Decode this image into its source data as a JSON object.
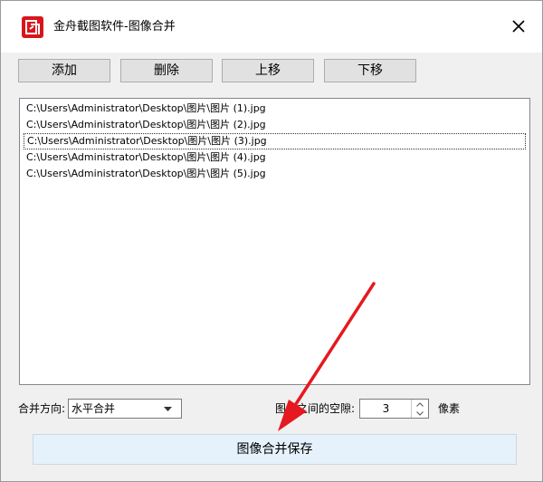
{
  "window": {
    "title": "金舟截图软件-图像合并"
  },
  "toolbar": {
    "add_label": "添加",
    "delete_label": "删除",
    "move_up_label": "上移",
    "move_down_label": "下移"
  },
  "file_list": {
    "items": [
      "C:\\Users\\Administrator\\Desktop\\图片\\图片 (1).jpg",
      "C:\\Users\\Administrator\\Desktop\\图片\\图片 (2).jpg",
      "C:\\Users\\Administrator\\Desktop\\图片\\图片 (3).jpg",
      "C:\\Users\\Administrator\\Desktop\\图片\\图片 (4).jpg",
      "C:\\Users\\Administrator\\Desktop\\图片\\图片 (5).jpg"
    ],
    "focused_index": 2
  },
  "options": {
    "direction_label": "合并方向:",
    "direction_value": "水平合并",
    "gap_label": "图像之间的空隙:",
    "gap_value": "3",
    "gap_unit": "像素"
  },
  "actions": {
    "save_label": "图像合并保存"
  },
  "colors": {
    "app_icon": "#d8151c",
    "annotation_arrow": "#e5191f",
    "save_button_bg": "#e5f1fb"
  },
  "icons": {
    "app": "app-logo-icon",
    "close": "close-icon",
    "combo": "chevron-down-icon",
    "spin_up": "chevron-up-icon",
    "spin_down": "chevron-down-icon"
  }
}
